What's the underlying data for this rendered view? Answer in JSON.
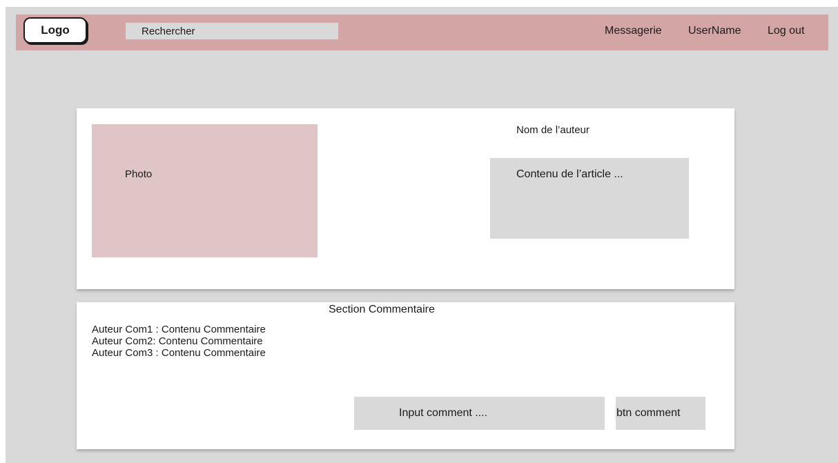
{
  "header": {
    "logo_label": "Logo",
    "search_placeholder": "Rechercher",
    "nav": {
      "messagerie": "Messagerie",
      "username": "UserName",
      "logout": "Log out"
    }
  },
  "article": {
    "photo_label": "Photo",
    "author_name": "Nom de l’auteur",
    "content": "Contenu de l’article ..."
  },
  "comments": {
    "section_title": "Section Commentaire",
    "items": [
      "Auteur Com1 : Contenu Commentaire",
      "Auteur Com2: Contenu Commentaire",
      "Auteur Com3 : Contenu Commentaire"
    ],
    "input_placeholder": "Input comment ....",
    "button_label": "btn comment"
  },
  "colors": {
    "header_bg": "#d4a5a5",
    "photo_bg": "#dfc5c5",
    "page_bg": "#d9d9d9",
    "card_bg": "#ffffff"
  }
}
